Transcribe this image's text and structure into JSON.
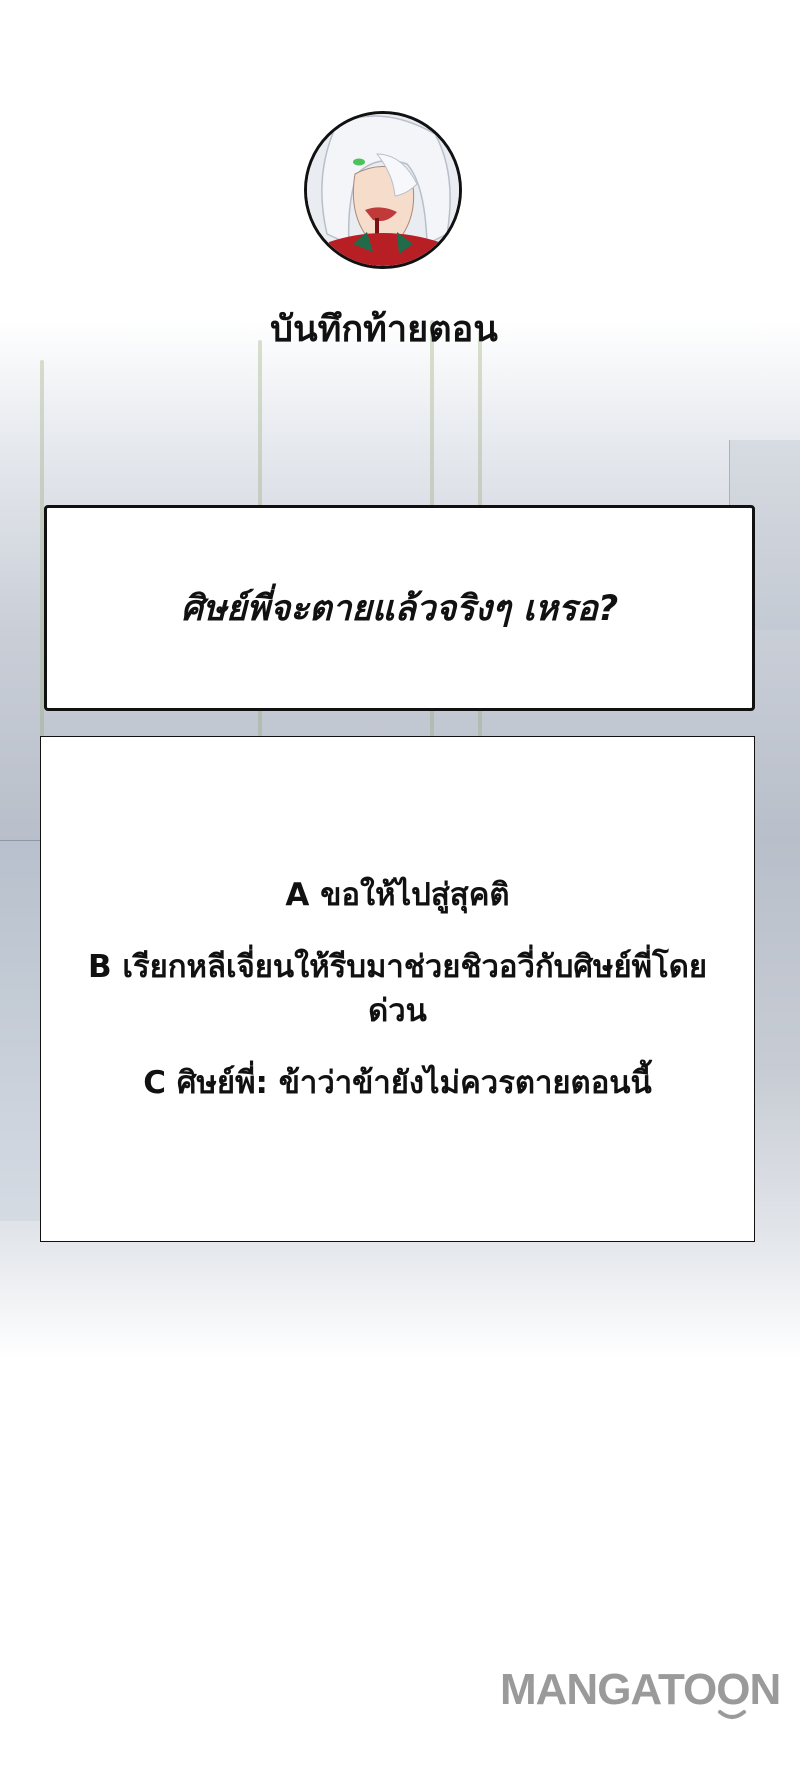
{
  "title": "บันทึกท้ายตอน",
  "question": "ศิษย์พี่จะตายแล้วจริงๆ เหรอ?",
  "options": [
    "A ขอให้ไปสู่สุคติ",
    "B เรียกหลีเจี่ยนให้รีบมาช่วยชิวอวี่กับศิษย์พี่โดยด่วน",
    "C ศิษย์พี่: ข้าว่าข้ายังไม่ควรตายตอนนี้"
  ],
  "logo": {
    "text": "MANGATOON",
    "color": "#9a9a9a"
  },
  "colors": {
    "text": "#111111",
    "background": "#ffffff"
  }
}
